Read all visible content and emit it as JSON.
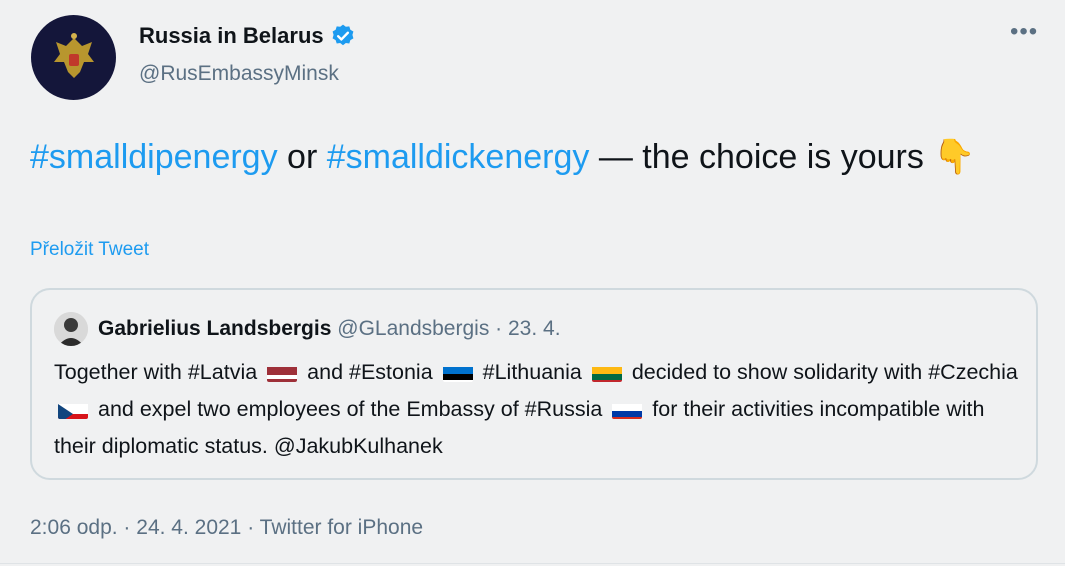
{
  "author": {
    "name": "Russia in Belarus",
    "handle": "@RusEmbassyMinsk",
    "verified": true
  },
  "tweet": {
    "hashtag_1": "#smalldipenergy",
    "word_or": " or ",
    "hashtag_2": "#smalldickenergy",
    "rest": " — the choice is yours ",
    "emoji": "👇",
    "translate_label": "Přeložit Tweet"
  },
  "quote": {
    "name": "Gabrielius Landsbergis",
    "handle": "@GLandsbergis",
    "dot": " · ",
    "date": "23. 4.",
    "text_1": "Together with #Latvia",
    "text_2": "and #Estonia",
    "text_3": "#Lithuania",
    "text_4": "decided to show solidarity with #Czechia",
    "text_5": "and expel two employees of the Embassy of #Russia",
    "text_6": "for their activities incompatible with their diplomatic status. @JakubKulhanek"
  },
  "meta": {
    "time": "2:06 odp.",
    "sep1": " · ",
    "date": "24. 4. 2021",
    "sep2": " · ",
    "source": "Twitter for iPhone"
  },
  "more_label": "•••",
  "colors": {
    "link": "#1d9bf0",
    "secondary": "#5b7083",
    "background": "#f0f1f2"
  }
}
